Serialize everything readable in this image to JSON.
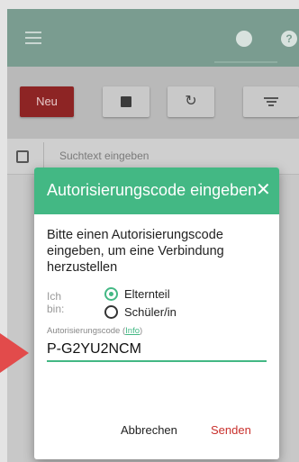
{
  "header": {
    "menu_icon": "menu-icon",
    "account_icon": "account-icon",
    "help_icon": "help-icon",
    "help_glyph": "?",
    "brand_color": "#7a9c90"
  },
  "toolbar": {
    "new_label": "Neu",
    "new_color": "#8d2424",
    "archive_icon": "archive-icon",
    "reload_icon": "reload-icon",
    "filter_icon": "filter-icon"
  },
  "search": {
    "placeholder": "Suchtext eingeben"
  },
  "dialog": {
    "title": "Autorisierungscode eingeben",
    "close_icon": "close-icon",
    "message": "Bitte einen Autorisierungscode eingeben, um eine Verbindung herzustellen",
    "role_label": "Ich bin:",
    "options": [
      {
        "label": "Elternteil",
        "checked": true
      },
      {
        "label": "Schüler/in",
        "checked": false
      }
    ],
    "code_label_prefix": "Autorisierungscode (",
    "code_label_link": "Info",
    "code_label_suffix": ")",
    "code_value": "P-G2YU2NCM",
    "cancel_label": "Abbrechen",
    "send_label": "Senden",
    "accent_color": "#43b884",
    "send_color": "#c9302c"
  },
  "pointer": {
    "color": "#e24b4b"
  }
}
